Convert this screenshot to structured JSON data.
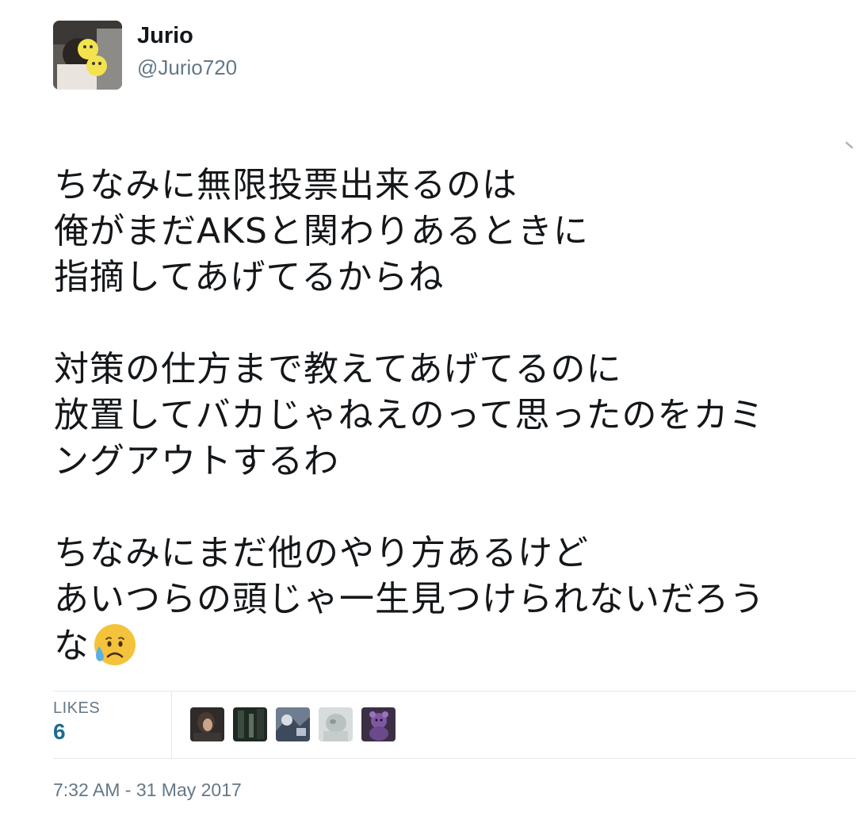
{
  "author": {
    "display_name": "Jurio",
    "handle": "@Jurio720",
    "avatar_icon": "user-avatar-photo"
  },
  "tweet": {
    "lines": [
      "ちなみに無限投票出来るのは",
      "俺がまだAKSと関わりあるときに",
      "指摘してあげてるからね",
      "",
      "対策の仕方まで教えてあげてるのに",
      "放置してバカじゃねえのって思ったのをカミ",
      "ングアウトするわ",
      "",
      "ちなみにまだ他のやり方あるけど",
      "あいつらの頭じゃ一生見つけられないだろう",
      "な"
    ],
    "trailing_emoji": "sad-relieved-face-emoji"
  },
  "stats": {
    "likes_label": "LIKES",
    "likes_count": "6",
    "liker_avatars": [
      "liker-avatar-1",
      "liker-avatar-2",
      "liker-avatar-3",
      "liker-avatar-4",
      "liker-avatar-5"
    ]
  },
  "timestamp": "7:32 AM - 31 May 2017",
  "colors": {
    "text": "#14171a",
    "secondary": "#657786",
    "likes_count": "#1c6b92",
    "divider": "#e1e8ed"
  }
}
